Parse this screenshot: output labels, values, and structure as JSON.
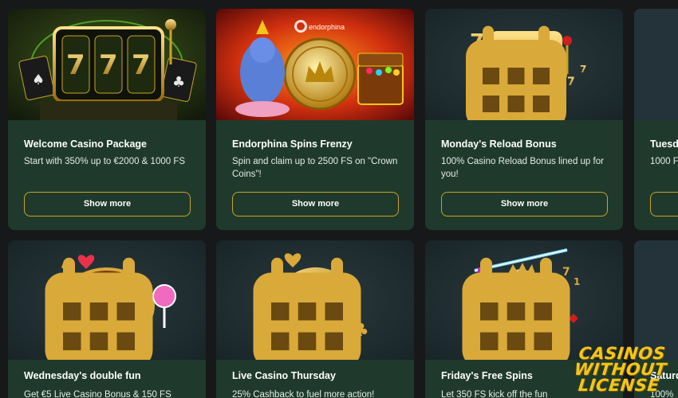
{
  "colors": {
    "page_bg": "#16181a",
    "card_bg": "#1f3a2c",
    "button_border": "#c9a227",
    "accent_gold": "#f5c518"
  },
  "cards": [
    {
      "title": "Welcome Casino Package",
      "desc": "Start with 350% up to €2000 & 1000 FS",
      "button": "Show more",
      "art_icon": "slot-machine-777"
    },
    {
      "title": "Endorphina Spins Frenzy",
      "desc": "Spin and claim up to 2500 FS on \"Crown Coins\"!",
      "button": "Show more",
      "art_icon": "ganesha-coin-treasure",
      "art_logo": "endorphina"
    },
    {
      "title": "Monday's Reload Bonus",
      "desc": "100% Casino Reload Bonus lined up for you!",
      "button": "Show more",
      "art_icon": "slot-machine-777"
    },
    {
      "title": "Tuesd",
      "desc": "1000 F",
      "art_icon": "calendar-icon"
    },
    {
      "title": "Wednesday's double fun",
      "desc": "Get €5 Live Casino Bonus & 150 FS",
      "art_icon": "roulette-wheel"
    },
    {
      "title": "Live Casino Thursday",
      "desc": "25% Cashback to fuel more action!",
      "art_icon": "spade-chip"
    },
    {
      "title": "Friday's Free Spins",
      "desc": "Let 350 FS kick off the fun",
      "art_icon": "zeus"
    },
    {
      "title": "Saturd",
      "desc": "100%",
      "art_icon": "calendar-icon"
    }
  ],
  "watermark": {
    "line1": "CASINOS",
    "line2": "WITHOUT",
    "line3": "LICENSE"
  }
}
